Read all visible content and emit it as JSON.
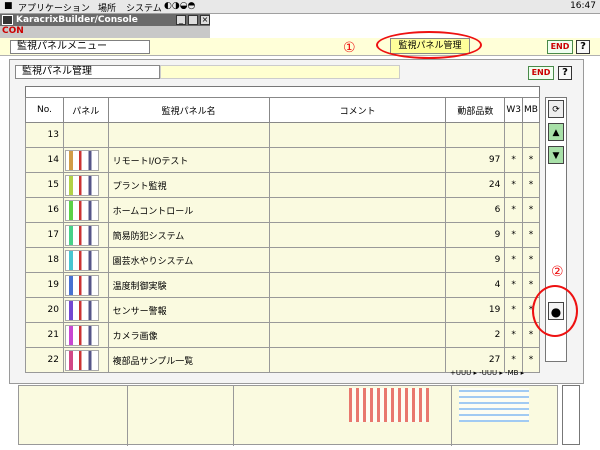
{
  "topbar": {
    "menus": [
      "アプリケーション",
      "場所",
      "システム"
    ],
    "clock": "16:47"
  },
  "app": {
    "title": "KaracrixBuilder/Console",
    "tool_label": "CON"
  },
  "menu_header": {
    "title": "監視パネルメニュー",
    "tab": "監視パネル管理",
    "end": "END",
    "help": "?"
  },
  "dialog": {
    "title": "監視パネル管理",
    "end": "END",
    "help": "?",
    "columns": [
      "No.",
      "パネル",
      "監視パネル名",
      "コメント",
      "動部品数",
      "W3",
      "MB"
    ],
    "rows": [
      {
        "no": "13",
        "name": "",
        "comment": "",
        "count": "",
        "w3": "",
        "mb": ""
      },
      {
        "no": "14",
        "name": "リモートI/Oテスト",
        "comment": "",
        "count": "97",
        "w3": "*",
        "mb": "*"
      },
      {
        "no": "15",
        "name": "プラント監視",
        "comment": "",
        "count": "24",
        "w3": "*",
        "mb": "*"
      },
      {
        "no": "16",
        "name": "ホームコントロール",
        "comment": "",
        "count": "6",
        "w3": "*",
        "mb": "*"
      },
      {
        "no": "17",
        "name": "簡易防犯システム",
        "comment": "",
        "count": "9",
        "w3": "*",
        "mb": "*"
      },
      {
        "no": "18",
        "name": "園芸水やりシステム",
        "comment": "",
        "count": "9",
        "w3": "*",
        "mb": "*"
      },
      {
        "no": "19",
        "name": "温度制御実験",
        "comment": "",
        "count": "4",
        "w3": "*",
        "mb": "*"
      },
      {
        "no": "20",
        "name": "センサー警報",
        "comment": "",
        "count": "19",
        "w3": "*",
        "mb": "*"
      },
      {
        "no": "21",
        "name": "カメラ画像",
        "comment": "",
        "count": "2",
        "w3": "*",
        "mb": "*"
      },
      {
        "no": "22",
        "name": "複部品サンプル一覧",
        "comment": "",
        "count": "27",
        "w3": "*",
        "mb": "*"
      }
    ],
    "footer": "+UUU ▸ -UUU ▸ -MB ▸"
  },
  "annotations": {
    "one": "①",
    "two": "②"
  },
  "icons": {
    "refresh": "refresh-icon",
    "up": "arrow-up-icon",
    "down": "arrow-down-icon",
    "dot": "dot-icon"
  },
  "colors": {
    "accent": "#e11111",
    "cell_bg": "#fafae0",
    "scroll_btn": "#a8e0a8"
  }
}
